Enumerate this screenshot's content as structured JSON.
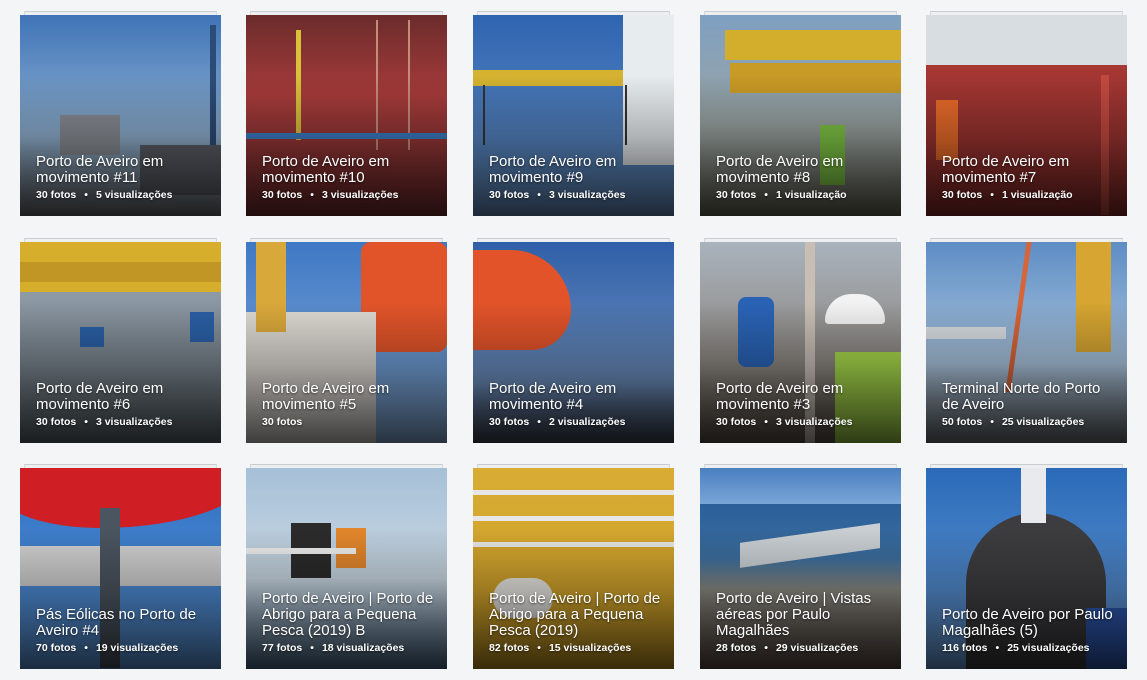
{
  "albums": [
    {
      "title": "Porto de Aveiro em movimento #11",
      "photos": "30 fotos",
      "views": "5 visualizações",
      "bg": "#4d7ab4"
    },
    {
      "title": "Porto de Aveiro em movimento #10",
      "photos": "30 fotos",
      "views": "3 visualizações",
      "bg": "#a73b3a"
    },
    {
      "title": "Porto de Aveiro em movimento #9",
      "photos": "30 fotos",
      "views": "3 visualizações",
      "bg": "#3d6bb0"
    },
    {
      "title": "Porto de Aveiro em movimento #8",
      "photos": "30 fotos",
      "views": "1 visualização",
      "bg": "#6c88a8"
    },
    {
      "title": "Porto de Aveiro em movimento #7",
      "photos": "30 fotos",
      "views": "1 visualização",
      "bg": "#a63733"
    },
    {
      "title": "Porto de Aveiro em movimento #6",
      "photos": "30 fotos",
      "views": "3 visualizações",
      "bg": "#6d6a58"
    },
    {
      "title": "Porto de Aveiro em movimento #5",
      "photos": "30 fotos",
      "views": "",
      "bg": "#4e7fbf"
    },
    {
      "title": "Porto de Aveiro em movimento #4",
      "photos": "30 fotos",
      "views": "2 visualizações",
      "bg": "#4169a8"
    },
    {
      "title": "Porto de Aveiro em movimento #3",
      "photos": "30 fotos",
      "views": "3 visualizações",
      "bg": "#7e7a76"
    },
    {
      "title": "Terminal Norte do Porto de Aveiro",
      "photos": "50 fotos",
      "views": "25 visualizações",
      "bg": "#6f97c2"
    },
    {
      "title": "Pás Eólicas no Porto de Aveiro #4",
      "photos": "70 fotos",
      "views": "19 visualizações",
      "bg": "#3a84d2"
    },
    {
      "title": "Porto de Aveiro | Porto de Abrigo para a Pequena Pesca (2019) B",
      "photos": "77 fotos",
      "views": "18 visualizações",
      "bg": "#8aa6bf"
    },
    {
      "title": "Porto de Aveiro | Porto de Abrigo para a Pequena Pesca (2019)",
      "photos": "82 fotos",
      "views": "15 visualizações",
      "bg": "#caa028"
    },
    {
      "title": "Porto de Aveiro | Vistas aéreas por Paulo Magalhães",
      "photos": "28 fotos",
      "views": "29 visualizações",
      "bg": "#3b5f8d"
    },
    {
      "title": "Porto de Aveiro por Paulo Magalhães (5)",
      "photos": "116 fotos",
      "views": "25 visualizações",
      "bg": "#2f6fb4"
    }
  ]
}
